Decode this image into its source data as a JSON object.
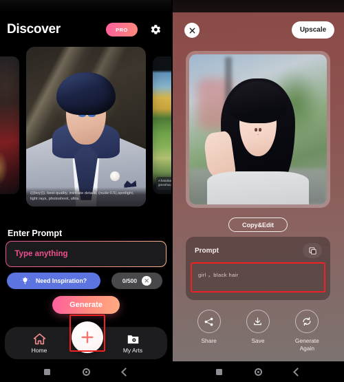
{
  "left": {
    "header": {
      "title": "Discover",
      "pro_label": "PRO",
      "settings_icon": "gear-icon"
    },
    "carousel": {
      "center_caption": "(((boy))), best quality, intricate details, (nude:0.5),spotlight, light rays, photoshoot, ultra",
      "right_caption": "A handsome greenhou"
    },
    "prompt": {
      "section_label": "Enter Prompt",
      "input_value": "",
      "input_placeholder": "Type anything",
      "inspiration_label": "Need Inspiration?",
      "inspiration_icon": "lightbulb-icon",
      "counter": "0/500",
      "clear_icon": "close-icon"
    },
    "generate_label": "Generate",
    "tabbar": {
      "home_label": "Home",
      "home_icon": "home-icon",
      "myarts_label": "My Arts",
      "myarts_icon": "photo-folder-icon",
      "fab_icon": "plus-icon"
    },
    "sysnav": {
      "recents_icon": "square-icon",
      "home_icon": "circle-icon",
      "back_icon": "chevron-left-icon"
    }
  },
  "right": {
    "close_icon": "close-icon",
    "upscale_label": "Upscale",
    "copyedit_label": "Copy&Edit",
    "prompt_card": {
      "title": "Prompt",
      "copy_icon": "copy-icon",
      "value": "girl ，black hair"
    },
    "actions": [
      {
        "label": "Share",
        "icon": "share-icon"
      },
      {
        "label": "Save",
        "icon": "download-icon"
      },
      {
        "label": "Generate\nAgain",
        "label_line1": "Generate",
        "label_line2": "Again",
        "icon": "refresh-icon"
      }
    ],
    "sysnav": {
      "recents_icon": "square-icon",
      "home_icon": "circle-icon",
      "back_icon": "chevron-left-icon"
    }
  },
  "annotations": {
    "color": "#ee2222",
    "boxes": [
      "fab-plus-button",
      "prompt-text-value"
    ]
  }
}
